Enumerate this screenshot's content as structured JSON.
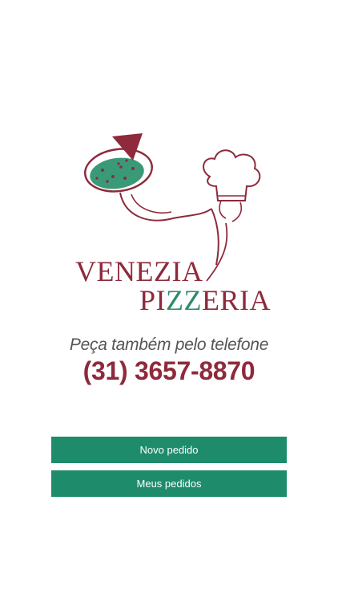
{
  "brand": {
    "name_line1": "VENEZIA",
    "name_line2_part1": "PI",
    "name_line2_part2": "ZZ",
    "name_line2_part3": "ERIA",
    "primary_color": "#8e2a3b",
    "secondary_color": "#1e8c6a"
  },
  "contact": {
    "caption": "Peça também pelo telefone",
    "phone": "(31) 3657-8870"
  },
  "actions": {
    "new_order_label": "Novo pedido",
    "my_orders_label": "Meus pedidos"
  },
  "icons": {
    "logo": "chef-with-pizza-icon"
  }
}
